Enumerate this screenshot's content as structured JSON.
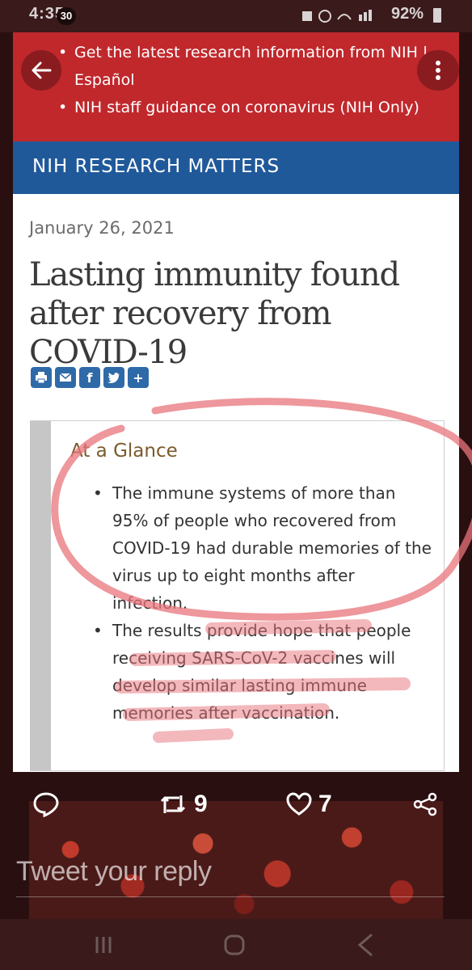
{
  "status_bar": {
    "time": "4:35",
    "notification_count": "30",
    "battery": "92%"
  },
  "alert": {
    "items": [
      "Get the latest research information from NIH | Español",
      "NIH staff guidance on coronavirus (NIH Only)"
    ]
  },
  "banner": {
    "label": "NIH RESEARCH MATTERS"
  },
  "article": {
    "date": "January 26, 2021",
    "title": "Lasting immunity found after recovery from COVID-19"
  },
  "share_icons": [
    "print-icon",
    "email-icon",
    "facebook-icon",
    "twitter-icon",
    "plus-icon"
  ],
  "glance": {
    "heading": "At a Glance",
    "bullets": [
      "The immune systems of more than 95% of people who recovered from COVID-19 had durable memories of the virus up to eight months after infection.",
      "The results provide hope that people receiving SARS-CoV-2 vaccines will develop similar lasting immune memories after vaccination."
    ]
  },
  "tweet_actions": {
    "retweets": "9",
    "likes": "7"
  },
  "reply": {
    "placeholder": "Tweet your reply"
  },
  "colors": {
    "alert_red": "#c0282c",
    "banner_blue": "#20599a",
    "overlay": "#2a0f10",
    "annotation_pink": "#e8747b"
  }
}
